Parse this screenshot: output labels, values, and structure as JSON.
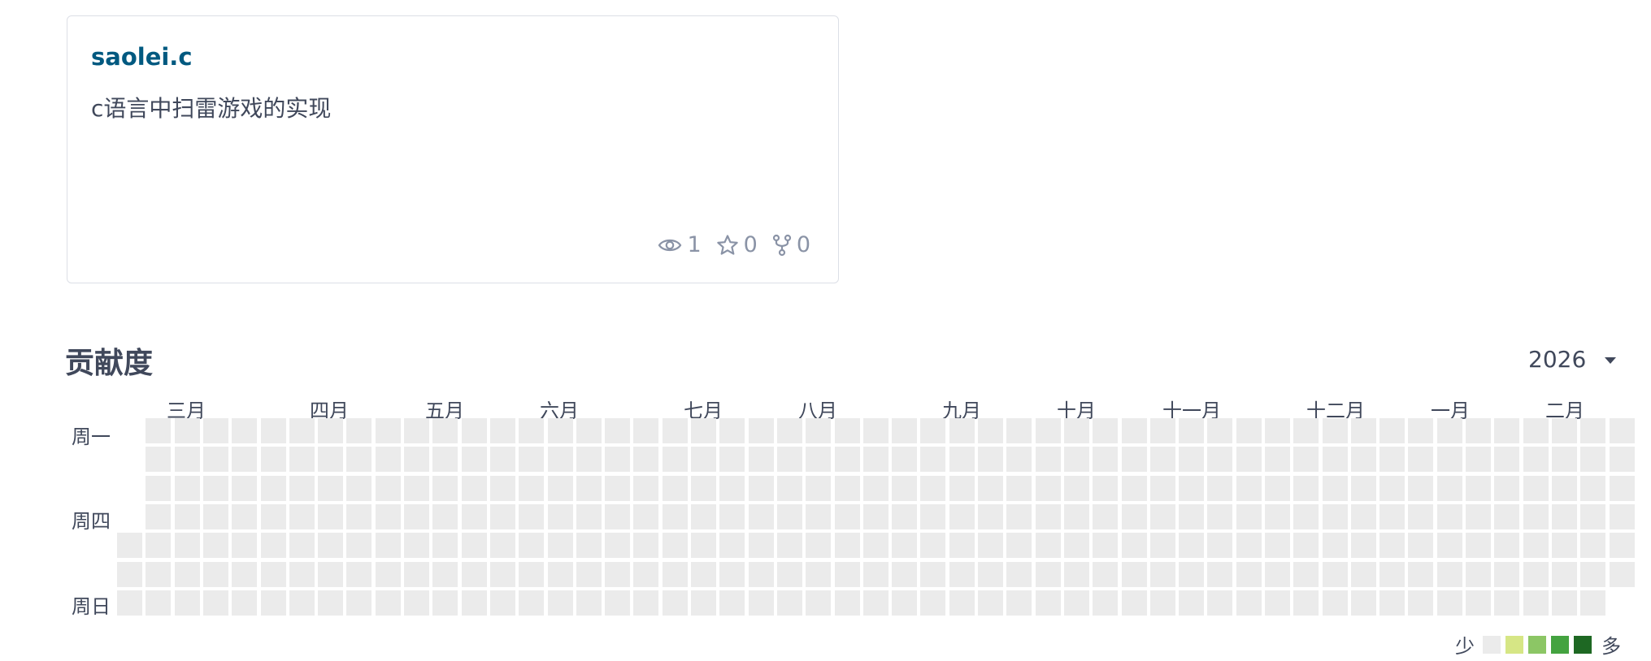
{
  "repo": {
    "name": "saolei.c",
    "description": "c语言中扫雷游戏的实现",
    "watchers": "1",
    "stars": "0",
    "forks": "0",
    "icons": {
      "watch": "eye-icon",
      "star": "star-icon",
      "fork": "fork-icon"
    }
  },
  "contribution": {
    "title": "贡献度",
    "year": "2026",
    "months": [
      "三月",
      "四月",
      "五月",
      "六月",
      "七月",
      "八月",
      "九月",
      "十月",
      "十一月",
      "十二月",
      "一月",
      "二月"
    ],
    "weekdays": [
      "周一",
      "周四",
      "周日"
    ],
    "legend": {
      "less": "少",
      "more": "多",
      "colors": [
        "#ebebeb",
        "#d6e685",
        "#8cc665",
        "#44a340",
        "#1e6823"
      ]
    },
    "empty_color": "#ebebeb",
    "link_color": "#005980"
  }
}
